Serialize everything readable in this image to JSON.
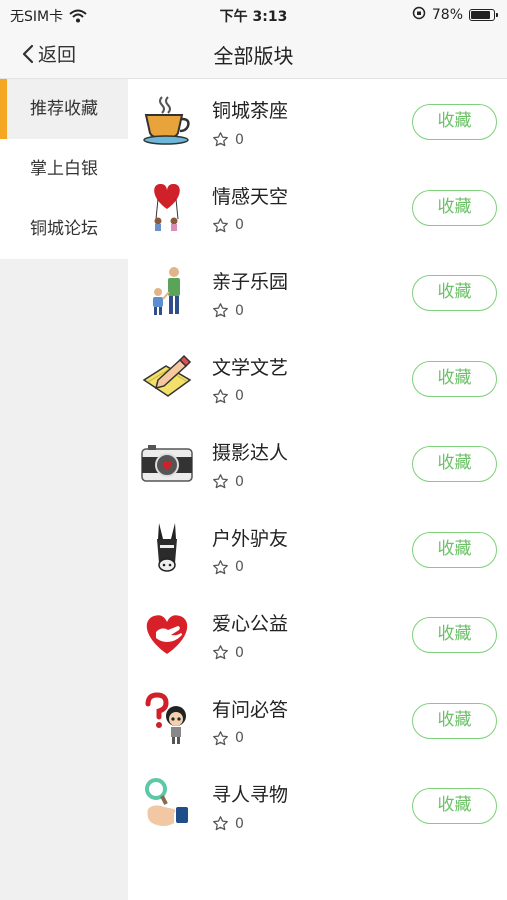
{
  "status_bar": {
    "carrier": "无SIM卡",
    "time": "下午 3:13",
    "battery": "78%"
  },
  "nav": {
    "back_label": "返回",
    "title": "全部版块"
  },
  "sidebar": {
    "items": [
      {
        "label": "推荐收藏",
        "active": true
      },
      {
        "label": "掌上白银",
        "active": false
      },
      {
        "label": "铜城论坛",
        "active": false
      }
    ]
  },
  "colors": {
    "accent": "#f5a623",
    "button_green": "#6cc167",
    "sidebar_bg": "#f0f0f0"
  },
  "boards": [
    {
      "name": "铜城茶座",
      "favorites": "0",
      "button": "收藏",
      "icon": "tea-cup-icon"
    },
    {
      "name": "情感天空",
      "favorites": "0",
      "button": "收藏",
      "icon": "heart-balloon-icon"
    },
    {
      "name": "亲子乐园",
      "favorites": "0",
      "button": "收藏",
      "icon": "parent-child-icon"
    },
    {
      "name": "文学文艺",
      "favorites": "0",
      "button": "收藏",
      "icon": "pencil-paper-icon"
    },
    {
      "name": "摄影达人",
      "favorites": "0",
      "button": "收藏",
      "icon": "camera-icon"
    },
    {
      "name": "户外驴友",
      "favorites": "0",
      "button": "收藏",
      "icon": "donkey-icon"
    },
    {
      "name": "爱心公益",
      "favorites": "0",
      "button": "收藏",
      "icon": "charity-heart-icon"
    },
    {
      "name": "有问必答",
      "favorites": "0",
      "button": "收藏",
      "icon": "question-girl-icon"
    },
    {
      "name": "寻人寻物",
      "favorites": "0",
      "button": "收藏",
      "icon": "magnifier-hand-icon"
    }
  ]
}
